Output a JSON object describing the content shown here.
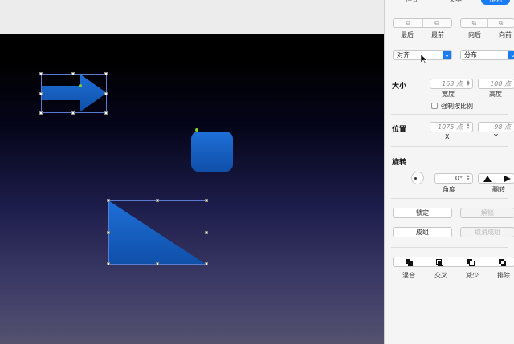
{
  "inspector": {
    "tabs": [
      "样式",
      "文本",
      "排列"
    ],
    "active_tab": "排列",
    "arrange": {
      "backmost_label": "最后",
      "frontmost_label": "最前",
      "backward_label": "向后",
      "forward_label": "向前",
      "align_select": "对齐",
      "distribute_select": "分布"
    },
    "size": {
      "title": "大小",
      "width_value": "163 点",
      "width_label": "宽度",
      "height_value": "100 点",
      "height_label": "高度",
      "constrain_label": "强制按比例"
    },
    "position": {
      "title": "位置",
      "x_value": "1075 点",
      "x_label": "X",
      "y_value": "98 点",
      "y_label": "Y"
    },
    "rotate": {
      "title": "旋转",
      "angle_value": "0°",
      "angle_label": "角度",
      "flip_label": "翻转"
    },
    "lock": {
      "lock_label": "锁定",
      "unlock_label": "解锁"
    },
    "group": {
      "group_label": "成组",
      "ungroup_label": "取消成组"
    },
    "boolean": {
      "union_label": "混合",
      "intersect_label": "交叉",
      "subtract_label": "减少",
      "exclude_label": "排除"
    }
  },
  "colors": {
    "shape_blue": "#1560c4",
    "accent": "#1a7cf4"
  },
  "icons": [
    "arrow-right-shape",
    "rounded-square-shape",
    "triangle-shape",
    "chevron-down-icon",
    "rotate-dial-icon",
    "flip-vertical-icon",
    "flip-horizontal-icon"
  ]
}
